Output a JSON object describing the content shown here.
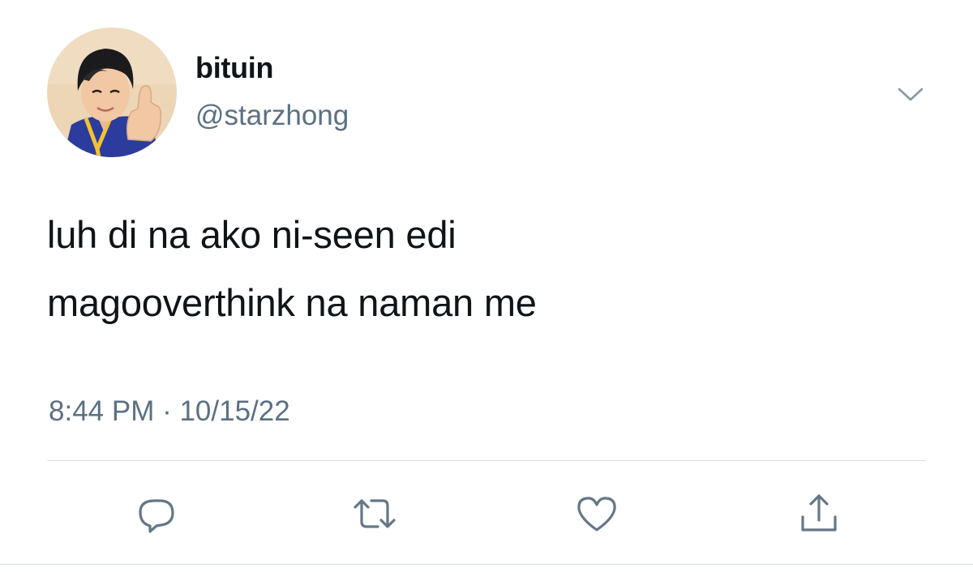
{
  "tweet": {
    "author": {
      "display_name": "bituin",
      "handle": "@starzhong",
      "avatar_icon": "profile-avatar"
    },
    "text_lines": [
      "luh di na ako ni-seen edi",
      "magooverthink na naman me"
    ],
    "timestamp": "8:44 PM · 10/15/22",
    "menu_icon": "chevron-down-icon"
  },
  "actions": [
    {
      "icon": "reply-icon"
    },
    {
      "icon": "retweet-icon"
    },
    {
      "icon": "like-icon"
    },
    {
      "icon": "share-icon"
    }
  ],
  "colors": {
    "text_primary": "#0f1419",
    "text_secondary": "#5b7083",
    "icon_gray": "#657786",
    "divider": "#d6dde2"
  }
}
